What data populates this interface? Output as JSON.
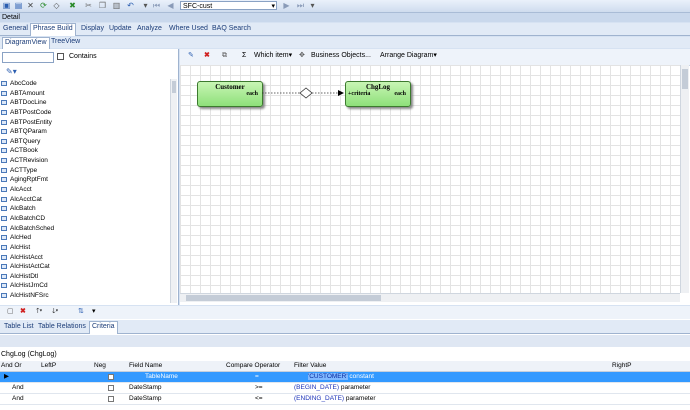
{
  "toolbar": {
    "combo_value": "SFC-cust",
    "icons": [
      "save-icon",
      "save-alt-icon",
      "close-icon",
      "sync-icon",
      "clear-icon",
      "delete-icon",
      "copy-icon",
      "paste-icon",
      "undo-icon",
      "first-icon",
      "prev-icon",
      "next-icon",
      "last-icon"
    ]
  },
  "detail_label": "Detail",
  "tabs": [
    "General",
    "Phrase Build",
    "Display",
    "Update",
    "Analyze",
    "Where Used",
    "BAQ Search"
  ],
  "subtabs": [
    "DiagramView",
    "TreeView"
  ],
  "left": {
    "contains_label": "Contains",
    "tables": [
      "AbcCode",
      "ABTAmount",
      "ABTDocLine",
      "ABTPostCode",
      "ABTPostEntity",
      "ABTQParam",
      "ABTQuery",
      "ACTBook",
      "ACTRevision",
      "ACTType",
      "AgingRptFmt",
      "AlcAcct",
      "AlcAcctCat",
      "AlcBatch",
      "AlcBatchCD",
      "AlcBatchSched",
      "AlcHed",
      "AlcHist",
      "AlcHistAcct",
      "AlcHistActCat",
      "AlcHistDtl",
      "AlcHistJrnCd",
      "AlcHistNFSrc"
    ]
  },
  "diagram_toolbar": {
    "which_item": "Which item",
    "business_objects": "Business Objects...",
    "arrange": "Arrange Diagram"
  },
  "nodes": {
    "customer": {
      "title": "Customer",
      "sub": "each"
    },
    "chglog": {
      "title": "ChgLog",
      "sub": "each",
      "criteria": "+criteria"
    }
  },
  "bottom_tabs": [
    "Table List",
    "Table Relations",
    "Criteria"
  ],
  "criteria_title": "ChgLog (ChgLog)",
  "grid": {
    "headers": [
      "And Or",
      "LeftP",
      "Neg",
      "Field Name",
      "Compare Operator",
      "Filter Value",
      "RightP"
    ],
    "rows": [
      {
        "andor": "",
        "field": "TableName",
        "op": "=",
        "value": "'CUSTOMER'",
        "kind": "constant"
      },
      {
        "andor": "And",
        "field": "DateStamp",
        "op": ">=",
        "value": "(BEGIN_DATE)",
        "kind": "parameter"
      },
      {
        "andor": "And",
        "field": "DateStamp",
        "op": "<=",
        "value": "(ENDING_DATE)",
        "kind": "parameter"
      }
    ]
  }
}
